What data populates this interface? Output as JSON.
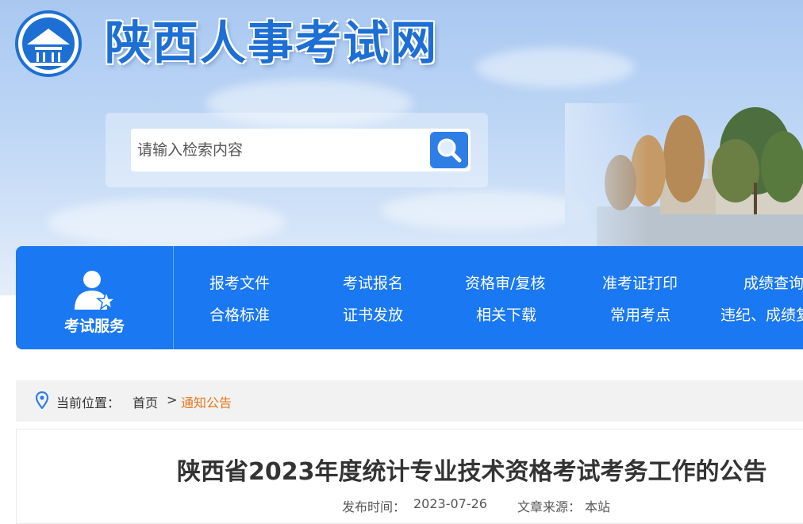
{
  "header": {
    "site_title": "陕西人事考试网",
    "logo_icon": "emblem-icon"
  },
  "search": {
    "placeholder": "请输入检索内容",
    "icon": "search-icon"
  },
  "service_nav": {
    "label": "考试服务",
    "icon": "user-star-icon",
    "row1": [
      "报考文件",
      "考试报名",
      "资格审/复核",
      "准考证打印",
      "成绩查询"
    ],
    "row2": [
      "合格标准",
      "证书发放",
      "相关下载",
      "常用考点",
      "违纪、成绩复"
    ]
  },
  "breadcrumb": {
    "label": "当前位置：",
    "home": "首页",
    "separator": ">",
    "current": "通知公告",
    "icon": "location-pin-icon"
  },
  "article": {
    "title": "陕西省2023年度统计专业技术资格考试考务工作的公告",
    "published_label": "发布时间：",
    "published_date": "2023-07-26",
    "source_label": "文章来源：",
    "source": "本站"
  },
  "colors": {
    "primary_blue": "#1a78f2",
    "title_blue": "#1d6fd4",
    "breadcrumb_active": "#e9781d"
  }
}
